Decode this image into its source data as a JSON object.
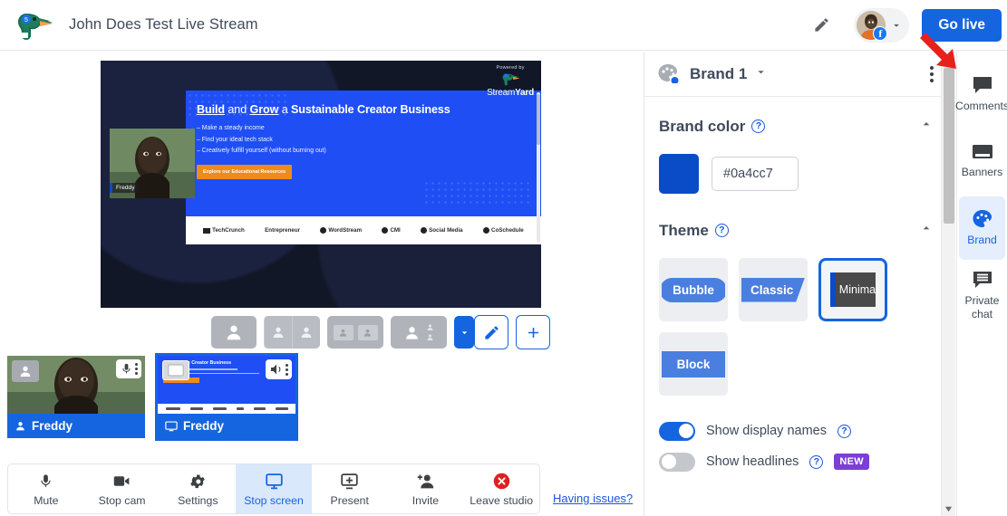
{
  "header": {
    "logo_icon": "duck-logo",
    "title": "John Does Test Live Stream",
    "edit_icon": "pencil-icon",
    "account_badge": "facebook-badge",
    "account_badge_letter": "f",
    "chevron_icon": "chevron-down-icon",
    "go_live_label": "Go live"
  },
  "stage": {
    "watermark": {
      "prefix": "Powered by",
      "name_light": "Stream",
      "name_bold": "Yard"
    },
    "shared_screen": {
      "heading_link1": "Build",
      "heading_mid": " and ",
      "heading_link2": "Grow",
      "heading_rest": " a ",
      "heading_bold": "Sustainable Creator Business",
      "bullets": [
        "– Make a steady income",
        "– Find your ideal tech stack",
        "– Creatively fulfill yourself (without burning out)"
      ],
      "cta": "Explore our Educational Resources",
      "logos": [
        "TechCrunch",
        "Entrepreneur",
        "WordStream",
        "CMI",
        "Social Media",
        "CoSchedule"
      ]
    },
    "camera_overlay_name": "Freddy",
    "layouts": [
      {
        "name": "layout-solo",
        "icon": "single-person-layout-icon"
      },
      {
        "name": "layout-split",
        "icon": "two-person-split-layout-icon"
      },
      {
        "name": "layout-pip",
        "icon": "picture-in-picture-layout-icon"
      },
      {
        "name": "layout-leader",
        "icon": "leader-and-list-layout-icon"
      }
    ],
    "layout_more_icon": "chevron-down-icon",
    "edit_layout_icon": "pencil-icon",
    "add_layout_icon": "plus-icon"
  },
  "tiles": [
    {
      "name": "Freddy",
      "type": "camera",
      "label_icon": "person-icon",
      "control_icon": "microphone-icon",
      "menu_icon": "kebab-menu-icon",
      "selected": false
    },
    {
      "name": "Freddy",
      "type": "screen",
      "label_icon": "monitor-icon",
      "control_icon": "speaker-icon",
      "menu_icon": "kebab-menu-icon",
      "selected": true
    }
  ],
  "bottom_bar": {
    "items": [
      {
        "label": "Mute",
        "icon": "microphone-icon",
        "active": false
      },
      {
        "label": "Stop cam",
        "icon": "video-camera-icon",
        "active": false
      },
      {
        "label": "Settings",
        "icon": "gear-icon",
        "active": false
      },
      {
        "label": "Stop screen",
        "icon": "monitor-icon",
        "active": true
      },
      {
        "label": "Present",
        "icon": "present-plus-icon",
        "active": false
      },
      {
        "label": "Invite",
        "icon": "person-add-icon",
        "active": false
      },
      {
        "label": "Leave studio",
        "icon": "red-x-circle-icon",
        "active": false
      }
    ],
    "help_link": "Having issues?"
  },
  "brand_panel": {
    "palette_icon": "palette-icon",
    "brand_name": "Brand 1",
    "brand_chevron_icon": "chevron-down-icon",
    "kebab_icon": "kebab-menu-icon",
    "brand_color": {
      "title": "Brand color",
      "help_icon": "help-circle-icon",
      "collapse_icon": "chevron-up-icon",
      "value": "#0a4cc7",
      "swatch_color": "#0a4cc7"
    },
    "theme": {
      "title": "Theme",
      "help_icon": "help-circle-icon",
      "collapse_icon": "chevron-up-icon",
      "options": [
        {
          "label": "Bubble",
          "selected": false
        },
        {
          "label": "Classic",
          "selected": false
        },
        {
          "label": "Minimal",
          "selected": true
        },
        {
          "label": "Block",
          "selected": false
        }
      ]
    },
    "toggles": [
      {
        "label": "Show display names",
        "on": true,
        "help_icon": "help-circle-icon",
        "badge": null
      },
      {
        "label": "Show headlines",
        "on": false,
        "help_icon": "help-circle-icon",
        "badge": "NEW"
      }
    ]
  },
  "scrollbar": {
    "up_icon": "caret-up-icon",
    "down_icon": "caret-down-icon"
  },
  "right_rail": [
    {
      "label": "Comments",
      "icon": "comment-icon",
      "active": false
    },
    {
      "label": "Banners",
      "icon": "banner-icon",
      "active": false
    },
    {
      "label": "Brand",
      "icon": "palette-icon",
      "active": true
    },
    {
      "label": "Private chat",
      "icon": "private-chat-icon",
      "active": false
    }
  ],
  "annotation": {
    "arrow": "red-arrow-pointing-to-account-dropdown",
    "color": "#e8201c"
  }
}
